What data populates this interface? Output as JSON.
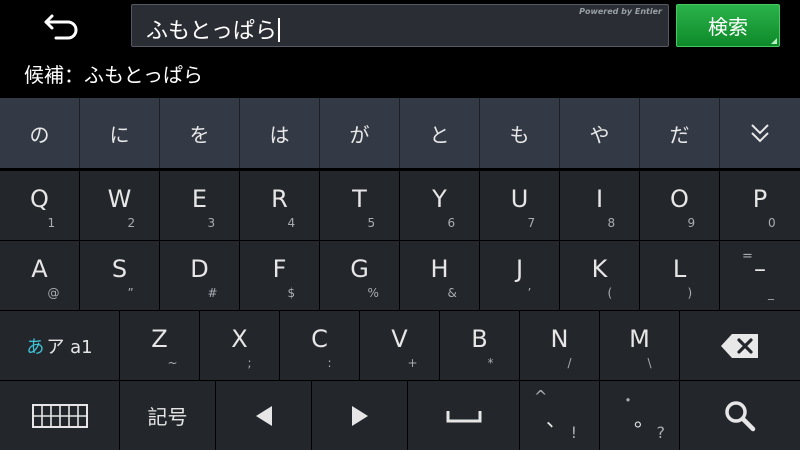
{
  "header": {
    "input_value": "ふもとっぱら",
    "powered_by": "Powered by Entier",
    "search_label": "検索"
  },
  "candidate_bar": {
    "text": "候補：ふもとっぱら"
  },
  "suggestions": [
    "の",
    "に",
    "を",
    "は",
    "が",
    "と",
    "も",
    "や",
    "だ"
  ],
  "rows": {
    "qwerty": [
      {
        "main": "Q",
        "sub": "1"
      },
      {
        "main": "W",
        "sub": "2"
      },
      {
        "main": "E",
        "sub": "3"
      },
      {
        "main": "R",
        "sub": "4"
      },
      {
        "main": "T",
        "sub": "5"
      },
      {
        "main": "Y",
        "sub": "6"
      },
      {
        "main": "U",
        "sub": "7"
      },
      {
        "main": "I",
        "sub": "8"
      },
      {
        "main": "O",
        "sub": "9"
      },
      {
        "main": "P",
        "sub": "0"
      }
    ],
    "asdf": [
      {
        "main": "A",
        "sub": "@"
      },
      {
        "main": "S",
        "sub": "”"
      },
      {
        "main": "D",
        "sub": "#"
      },
      {
        "main": "F",
        "sub": "$"
      },
      {
        "main": "G",
        "sub": "%"
      },
      {
        "main": "H",
        "sub": "&"
      },
      {
        "main": "J",
        "sub": "’"
      },
      {
        "main": "K",
        "sub": "("
      },
      {
        "main": "L",
        "sub": ")"
      },
      {
        "main": "–",
        "sub": "_",
        "top": "="
      }
    ],
    "zxcv": [
      {
        "main": "Z",
        "sub": "~"
      },
      {
        "main": "X",
        "sub": ";"
      },
      {
        "main": "C",
        "sub": ":"
      },
      {
        "main": "V",
        "sub": "+"
      },
      {
        "main": "B",
        "sub": "*"
      },
      {
        "main": "N",
        "sub": "/"
      },
      {
        "main": "M",
        "sub": "\\"
      }
    ],
    "mode_key": {
      "hira": "あ",
      "rest": "ア a1"
    },
    "bottom": {
      "symbols_label": "記号",
      "punct1_top": "^",
      "punct1_main": "、",
      "punct1_sub": "!",
      "punct2_top": "・",
      "punct2_main": "。",
      "punct2_sub": "?"
    }
  },
  "colors": {
    "accent": "#0e8a2a",
    "mode_hira": "#3fc3d6"
  }
}
